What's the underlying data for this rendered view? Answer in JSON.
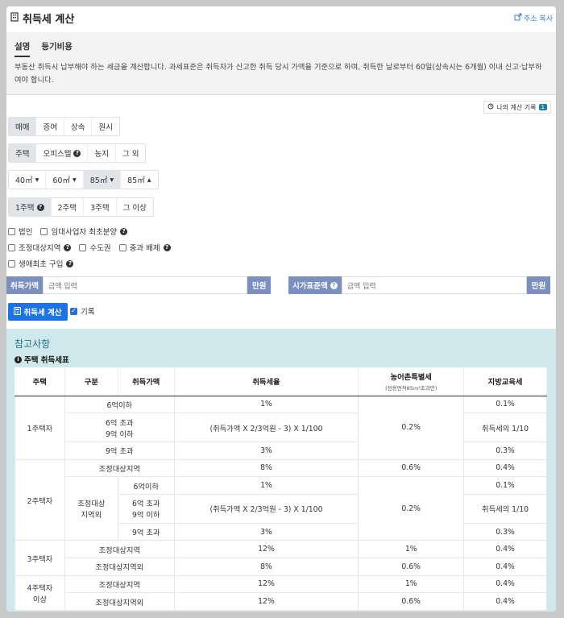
{
  "header": {
    "title": "취득세 계산",
    "share_label": "주소 복사"
  },
  "tabs": [
    {
      "label": "설명"
    },
    {
      "label": "등기비용"
    }
  ],
  "description": "부동산 취득시 납부해야 하는 세금을 계산합니다. 과세표준은 취득자가 신고한 취득 당시 가액을 기준으로 하며, 취득한 날로부터 60일(상속시는 6개월) 이내 신고·납부하여야 합니다.",
  "history": {
    "label": "나의 계산 기록",
    "count": "1"
  },
  "trade_types": [
    "매매",
    "증여",
    "상속",
    "원시"
  ],
  "property_types": [
    "주택",
    "오피스텔",
    "농지",
    "그 외"
  ],
  "area_options": [
    "40㎡",
    "60㎡",
    "85㎡",
    "85㎡"
  ],
  "house_counts": [
    "1주택",
    "2주택",
    "3주택",
    "그 이상"
  ],
  "checkboxes": {
    "corp": "법인",
    "rental": "임대사업자 최초분양",
    "adjust": "조정대상지역",
    "metro": "수도권",
    "exclude": "중과 배제",
    "first": "생애최초 구입"
  },
  "inputs": {
    "price_label": "취득가액",
    "price_placeholder": "금액 입력",
    "price_unit": "만원",
    "std_label": "시가표준액",
    "std_placeholder": "금액 입력",
    "std_unit": "만원"
  },
  "calc_button": "취득세 계산",
  "record_label": "기록",
  "reference": {
    "title": "참고사항",
    "table_title": "주택 취득세표",
    "headers": {
      "house": "주택",
      "category": "구분",
      "price": "취득가액",
      "rate": "취득세율",
      "rural": "농어촌특별세",
      "rural_sub": "(전용면적85m²초과만)",
      "edu": "지방교육세"
    },
    "rows": {
      "h1": "1주택자",
      "h1_r1_price": "6억이하",
      "h1_r1_rate": "1%",
      "h1_r1_edu": "0.1%",
      "h1_r2_price_a": "6억 초과",
      "h1_r2_price_b": "9억 이하",
      "h1_r2_rate": "(취득가액 X 2/3억원 - 3) X 1/100",
      "h1_r2_edu": "취득세의 1/10",
      "h1_r3_price": "9억 초과",
      "h1_r3_rate": "3%",
      "h1_r3_edu": "0.3%",
      "h1_rural": "0.2%",
      "h2": "2주택자",
      "h2_adj": "조정대상지역",
      "h2_adj_rate": "8%",
      "h2_adj_rural": "0.6%",
      "h2_adj_edu": "0.4%",
      "h2_nonadj_a": "조정대상",
      "h2_nonadj_b": "지역외",
      "h2_r1_price": "6억이하",
      "h2_r1_rate": "1%",
      "h2_r1_edu": "0.1%",
      "h2_r2_price_a": "6억 초과",
      "h2_r2_price_b": "9억 이하",
      "h2_r2_rate": "(취득가액 X 2/3억원 - 3) X 1/100",
      "h2_r2_edu": "취득세의 1/10",
      "h2_r3_price": "9억 초과",
      "h2_r3_rate": "3%",
      "h2_r3_edu": "0.3%",
      "h2_nonadj_rural": "0.2%",
      "h3": "3주택자",
      "h3_adj": "조정대상지역",
      "h3_adj_rate": "12%",
      "h3_adj_rural": "1%",
      "h3_adj_edu": "0.4%",
      "h3_non": "조정대상지역외",
      "h3_non_rate": "8%",
      "h3_non_rural": "0.6%",
      "h3_non_edu": "0.4%",
      "h4_a": "4주택자",
      "h4_b": "이상",
      "h4_adj": "조정대상지역",
      "h4_adj_rate": "12%",
      "h4_adj_rural": "1%",
      "h4_adj_edu": "0.4%",
      "h4_non": "조정대상지역외",
      "h4_non_rate": "12%",
      "h4_non_rural": "0.6%",
      "h4_non_edu": "0.4%"
    }
  }
}
